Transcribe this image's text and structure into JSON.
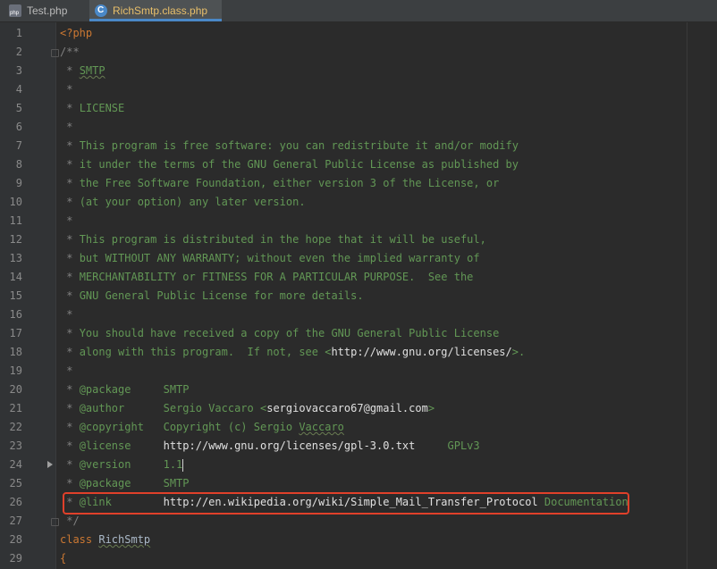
{
  "tabs": [
    {
      "label": "Test.php",
      "icon": "php-file-icon",
      "active": false
    },
    {
      "label": "RichSmtp.class.php",
      "icon": "php-class-icon",
      "active": true
    }
  ],
  "lines": [
    "<?php",
    "/**",
    " * SMTP",
    " *",
    " * LICENSE",
    " *",
    " * This program is free software: you can redistribute it and/or modify",
    " * it under the terms of the GNU General Public License as published by",
    " * the Free Software Foundation, either version 3 of the License, or",
    " * (at your option) any later version.",
    " *",
    " * This program is distributed in the hope that it will be useful,",
    " * but WITHOUT ANY WARRANTY; without even the implied warranty of",
    " * MERCHANTABILITY or FITNESS FOR A PARTICULAR PURPOSE.  See the",
    " * GNU General Public License for more details.",
    " *",
    " * You should have received a copy of the GNU General Public License",
    " * along with this program.  If not, see <http://www.gnu.org/licenses/>.",
    " *",
    " * @package     SMTP",
    " * @author      Sergio Vaccaro <sergiovaccaro67@gmail.com>",
    " * @copyright   Copyright (c) Sergio Vaccaro",
    " * @license     http://www.gnu.org/licenses/gpl-3.0.txt     GPLv3",
    " * @version     1.1",
    " * @package     SMTP",
    " * @link        http://en.wikipedia.org/wiki/Simple_Mail_Transfer_Protocol Documentation",
    " */",
    "class RichSmtp",
    "{"
  ],
  "line_numbers": [
    "1",
    "2",
    "3",
    "4",
    "5",
    "6",
    "7",
    "8",
    "9",
    "10",
    "11",
    "12",
    "13",
    "14",
    "15",
    "16",
    "17",
    "18",
    "19",
    "20",
    "21",
    "22",
    "23",
    "24",
    "25",
    "26",
    "27",
    "28",
    "29"
  ],
  "colors": {
    "comment": "#629755",
    "keyword": "#cc7832",
    "highlight": "#e0402a",
    "tab_active_text": "#e8bf6a"
  }
}
